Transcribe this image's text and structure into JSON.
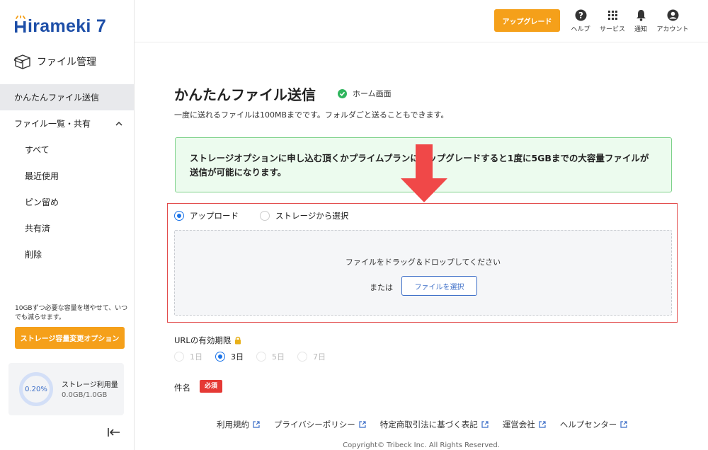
{
  "brand": {
    "logo_text": "irameki 7",
    "logo_letter": "H"
  },
  "sidebar": {
    "module_title": "ファイル管理",
    "items": [
      {
        "label": "かんたんファイル送信"
      },
      {
        "label": "ファイル一覧・共有"
      },
      {
        "label": "すべて"
      },
      {
        "label": "最近使用"
      },
      {
        "label": "ピン留め"
      },
      {
        "label": "共有済"
      },
      {
        "label": "削除"
      }
    ],
    "storage_note": "10GBずつ必要な容量を増やせて、いつでも減らせます。",
    "storage_button": "ストレージ容量変更オプション",
    "storage_usage": {
      "percent": "0.20%",
      "label": "ストレージ利用量",
      "value": "0.0GB/1.0GB"
    }
  },
  "header": {
    "upgrade_label": "アップグレード",
    "icons": [
      {
        "label": "ヘルプ",
        "icon": "help-icon"
      },
      {
        "label": "サービス",
        "icon": "grid-icon"
      },
      {
        "label": "通知",
        "icon": "bell-icon"
      },
      {
        "label": "アカウント",
        "icon": "account-icon"
      }
    ]
  },
  "main": {
    "title": "かんたんファイル送信",
    "home_badge": "ホーム画面",
    "subtitle": "一度に送れるファイルは100MBまでです。フォルダごと送ることもできます。",
    "info": "ストレージオプションに申し込む頂くかプライムプランにアップグレードすると1度に5GBまでの大容量ファイルが送信が可能になります。",
    "source_options": [
      "アップロード",
      "ストレージから選択"
    ],
    "dropzone_text": "ファイルをドラッグ＆ドロップしてください",
    "or_text": "または",
    "select_file": "ファイルを選択",
    "url_expiry_label": "URLの有効期限",
    "expiry_options": [
      "1日",
      "3日",
      "5日",
      "7日"
    ],
    "subject_label": "件名",
    "required_badge": "必須"
  },
  "footer": {
    "links": [
      "利用規約",
      "プライバシーポリシー",
      "特定商取引法に基づく表記",
      "運営会社",
      "ヘルプセンター"
    ],
    "copyright": "Copyright© Tribeck Inc. All Rights Reserved."
  },
  "colors": {
    "accent_orange": "#f5a01a",
    "brand_blue": "#1e4fa8",
    "alert_red": "#e53935",
    "success_green": "#2fb55d"
  }
}
